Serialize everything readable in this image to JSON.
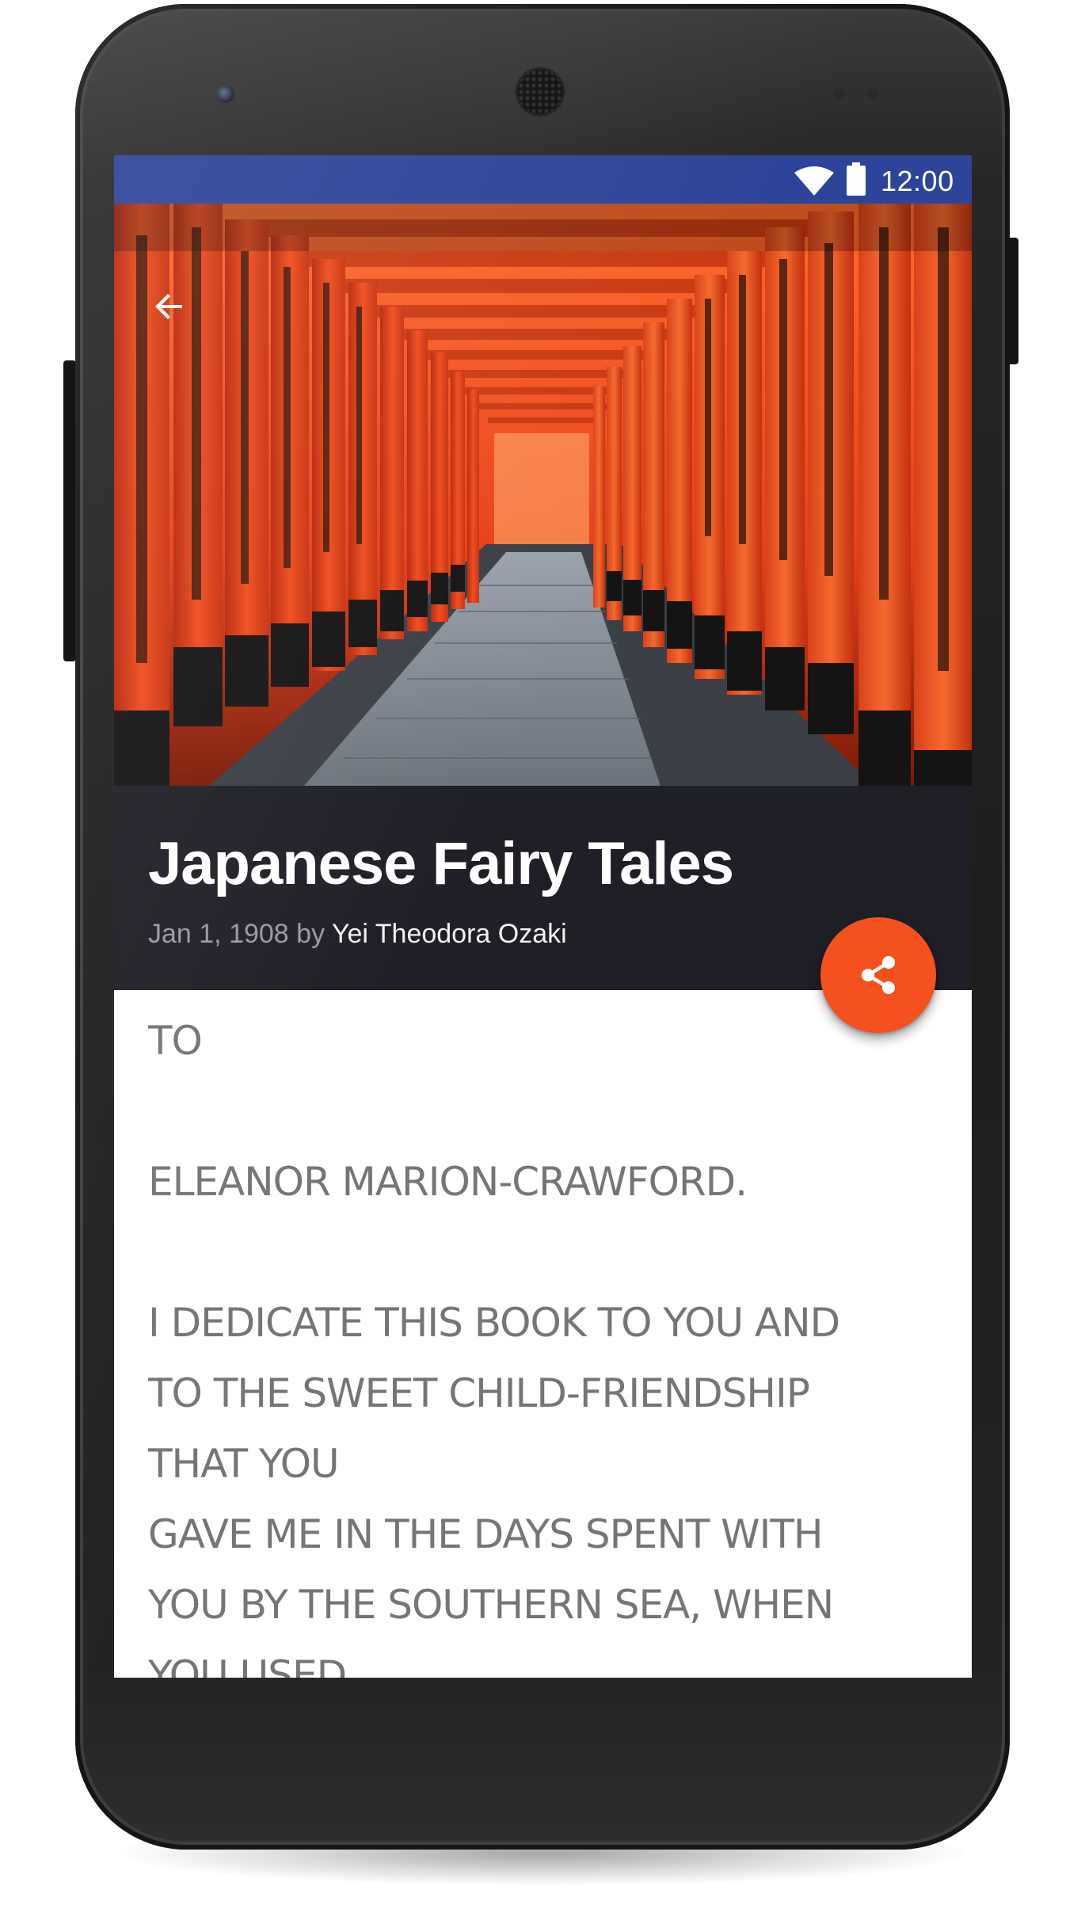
{
  "status_bar": {
    "time": "12:00",
    "wifi_icon": "wifi-icon",
    "battery_icon": "battery-icon",
    "background_color": "#2c4499"
  },
  "toolbar": {
    "back_icon": "arrow-back-icon"
  },
  "hero": {
    "subject": "torii-gate-tunnel"
  },
  "book": {
    "title": "Japanese Fairy Tales",
    "date": "Jan 1, 1908",
    "by": "by",
    "author": "Yei Theodora Ozaki"
  },
  "share": {
    "icon": "share-icon",
    "color": "#f4511e"
  },
  "content": {
    "paragraphs": [
      "TO",
      "ELEANOR MARION-CRAWFORD.",
      "I DEDICATE THIS BOOK TO YOU AND",
      "TO THE SWEET CHILD-FRIENDSHIP",
      "THAT YOU",
      "GAVE ME IN THE DAYS SPENT WITH",
      "YOU BY THE SOUTHERN SEA, WHEN",
      "YOU USED"
    ]
  },
  "colors": {
    "title_block": "#1f1f27",
    "body_text": "#757575",
    "accent": "#f4511e"
  }
}
